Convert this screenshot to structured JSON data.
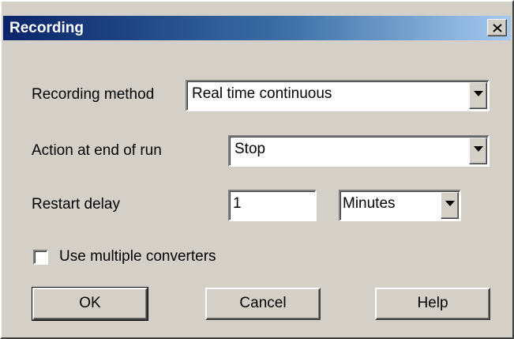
{
  "window": {
    "title": "Recording",
    "close_glyph": "✕"
  },
  "form": {
    "recording_method": {
      "label": "Recording method",
      "value": "Real time continuous"
    },
    "action_end": {
      "label": "Action at end of run",
      "value": "Stop"
    },
    "restart_delay": {
      "label": "Restart delay",
      "value": "1",
      "unit": "Minutes"
    },
    "multiple_converters": {
      "label": "Use multiple converters",
      "checked": false
    }
  },
  "buttons": {
    "ok": "OK",
    "cancel": "Cancel",
    "help": "Help"
  },
  "colors": {
    "face": "#d4d0c8",
    "titlebar_start": "#0a246a",
    "titlebar_end": "#a6caf0"
  },
  "icons": {
    "dropdown": "chevron-down-icon",
    "close": "close-icon"
  }
}
